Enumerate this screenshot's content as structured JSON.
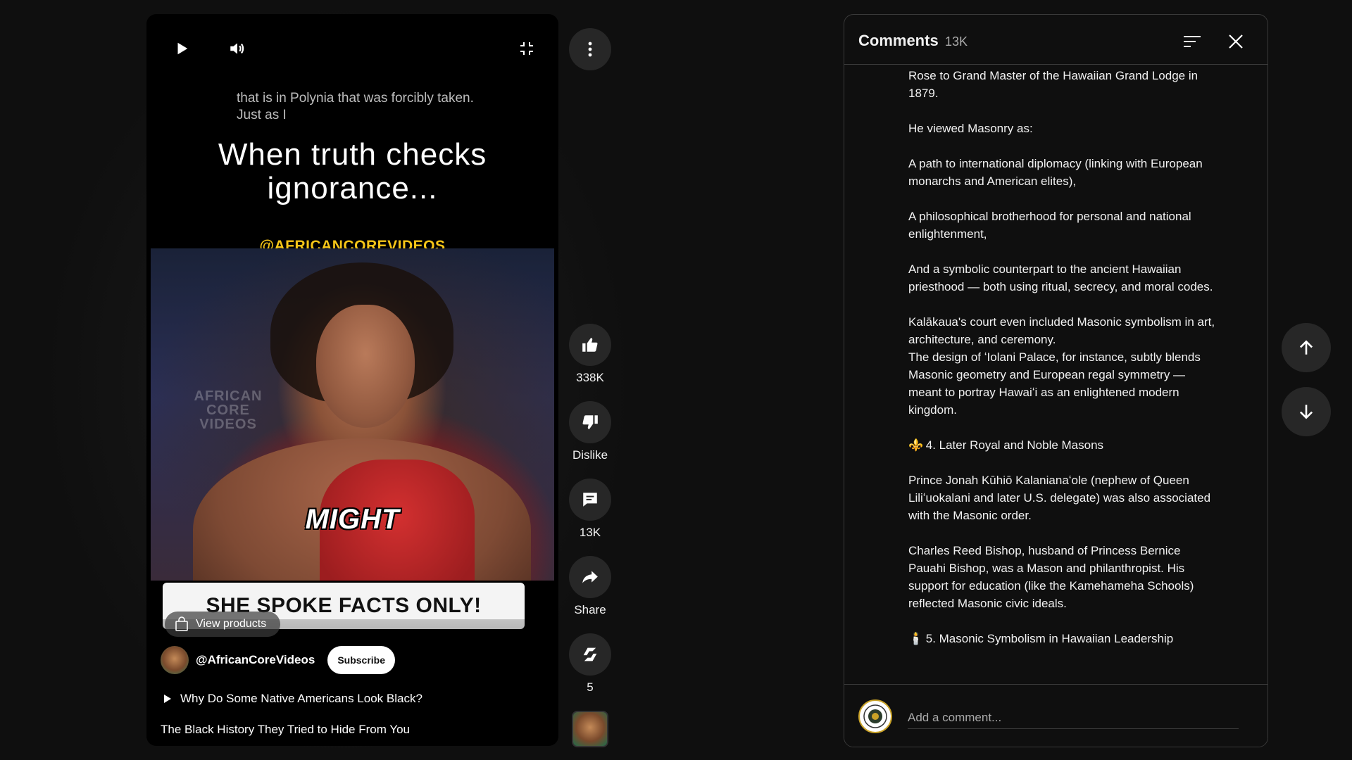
{
  "player": {
    "caption": "that is in Polynia that was forcibly taken. Just as I",
    "headline_line1": "When truth checks",
    "headline_line2": "ignorance...",
    "overlay_handle": "@AFRICANCOREVIDEOS",
    "watermark_line1": "AFRICAN",
    "watermark_line2": "CORE",
    "watermark_line3": "VIDEOS",
    "on_screen_word": "MIGHT",
    "banner_text": "SHE SPOKE FACTS ONLY!",
    "view_products_label": "View products",
    "channel_name": "@AfricanCoreVideos",
    "subscribe_label": "Subscribe",
    "related_title": "Why Do Some Native Americans Look Black?",
    "video_title": "The Black History They Tried to Hide From You",
    "progress_fraction": 0.43,
    "progress_color": "#ff0033"
  },
  "actions": {
    "like_count": "338K",
    "dislike_label": "Dislike",
    "comment_count": "13K",
    "share_label": "Share",
    "remix_count": "5"
  },
  "comments": {
    "title": "Comments",
    "count": "13K",
    "paragraphs": [
      "Rose to Grand Master of the Hawaiian Grand Lodge in 1879.",
      "He viewed Masonry as:",
      "A path to international diplomacy (linking with European monarchs and American elites),",
      "A philosophical brotherhood for personal and national enlightenment,",
      "And a symbolic counterpart to the ancient Hawaiian priesthood — both using ritual, secrecy, and moral codes.",
      "Kalākaua's court even included Masonic symbolism in art, architecture, and ceremony.",
      "The design of ʻIolani Palace, for instance, subtly blends Masonic geometry and European regal symmetry — meant to portray Hawaiʻi as an enlightened modern kingdom.",
      "4. Later Royal and Noble Masons",
      "Prince Jonah Kūhiō Kalanianaʻole (nephew of Queen Liliʻuokalani and later U.S. delegate) was also associated with the Masonic order.",
      "Charles Reed Bishop, husband of Princess Bernice Pauahi Bishop, was a Mason and philanthropist. His support for education (like the Kamehameha Schools) reflected Masonic civic ideals.",
      "5. Masonic Symbolism in Hawaiian Leadership"
    ],
    "emoji_section4": "⚜️",
    "emoji_section5": "🕯️",
    "add_comment_placeholder": "Add a comment..."
  },
  "icons": {
    "play": "play-icon",
    "volume": "volume-icon",
    "fullscreen_exit": "fullscreen-exit-icon",
    "more": "more-vert-icon",
    "like": "thumb-up-icon",
    "dislike": "thumb-down-icon",
    "comments": "comment-icon",
    "share": "share-icon",
    "remix": "remix-icon",
    "sort": "sort-icon",
    "close": "close-icon",
    "up": "arrow-up-icon",
    "down": "arrow-down-icon",
    "bag": "shopping-bag-icon"
  },
  "colors": {
    "background": "#0f0f0f",
    "button": "#272727",
    "accent_yellow": "#f5c518",
    "progress_red": "#ff0033"
  }
}
